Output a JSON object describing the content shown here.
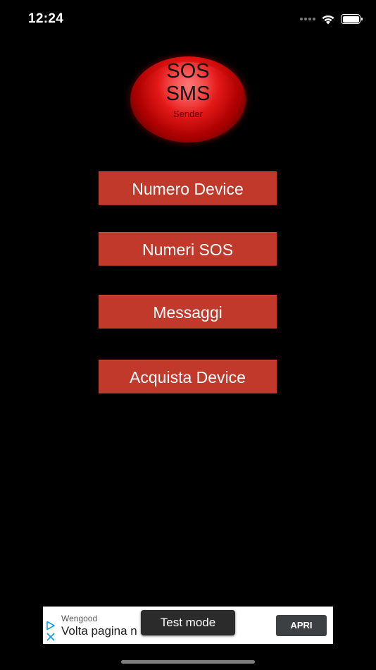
{
  "status_bar": {
    "time": "12:24",
    "icons": [
      "signal-dots-icon",
      "wifi-icon",
      "battery-icon"
    ]
  },
  "logo": {
    "line1": "SOS",
    "line2": "SMS",
    "line3": "Sender",
    "color": "#e01212"
  },
  "menu": {
    "button_color": "#c0392b",
    "items": [
      {
        "label": "Numero Device"
      },
      {
        "label": "Numeri SOS"
      },
      {
        "label": "Messaggi"
      },
      {
        "label": "Acquista Device"
      }
    ]
  },
  "ad": {
    "advertiser": "Wengood",
    "headline": "Volta pagina n",
    "cta": "APRI",
    "test_mode_label": "Test mode",
    "icons": [
      "ad-choices-play-icon",
      "ad-close-icon"
    ]
  }
}
